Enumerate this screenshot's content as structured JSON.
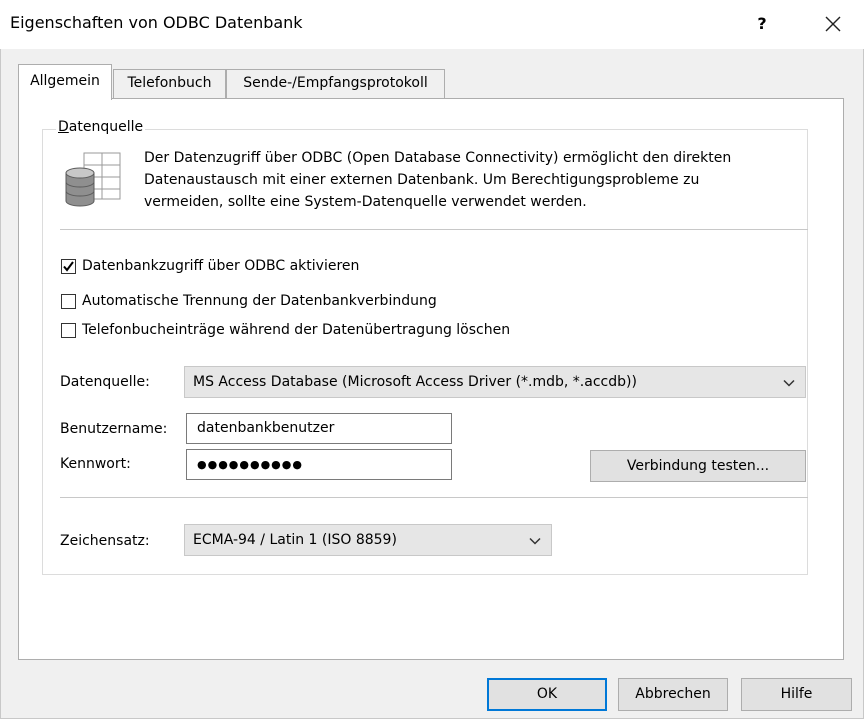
{
  "window": {
    "title": "Eigenschaften von ODBC Datenbank",
    "help_label": "?",
    "close_label": "✕"
  },
  "tabs": [
    {
      "label": "Allgemein",
      "active": true
    },
    {
      "label": "Telefonbuch",
      "active": false
    },
    {
      "label": "Sende-/Empfangsprotokoll",
      "active": false
    }
  ],
  "group": {
    "label": "Datenquelle",
    "icon": "database-table-icon",
    "description": [
      "Der Datenzugriff über ODBC (Open Database Connectivity) ermöglicht den direkten",
      "Datenaustausch mit einer externen Datenbank. Um Berechtigungsprobleme zu",
      "vermeiden, sollte eine System-Datenquelle verwendet werden."
    ]
  },
  "options": [
    {
      "label": "Datenbankzugriff über ODBC aktivieren",
      "checked": true
    },
    {
      "label": "Automatische Trennung der Datenbankverbindung",
      "checked": false
    },
    {
      "label": "Telefonbucheinträge während der Datenübertragung löschen",
      "checked": false
    }
  ],
  "fields": {
    "datasource_label": "Datenquelle:",
    "datasource_value": "MS Access Database (Microsoft Access Driver (*.mdb, *.accdb))",
    "username_label": "Benutzername:",
    "username_value": "datenbankbenutzer",
    "password_label": "Kennwort:",
    "password_value": "●●●●●●●●●●",
    "test_button_label": "Verbindung testen...",
    "charset_label": "Zeichensatz:",
    "charset_value": "ECMA-94 / Latin 1 (ISO 8859)"
  },
  "buttons": {
    "ok": "OK",
    "cancel": "Abbrechen",
    "help": "Hilfe"
  },
  "colors": {
    "focus_border": "#0078d7",
    "button_face": "#e1e1e1",
    "dialog_bg": "#f0f0f0"
  }
}
